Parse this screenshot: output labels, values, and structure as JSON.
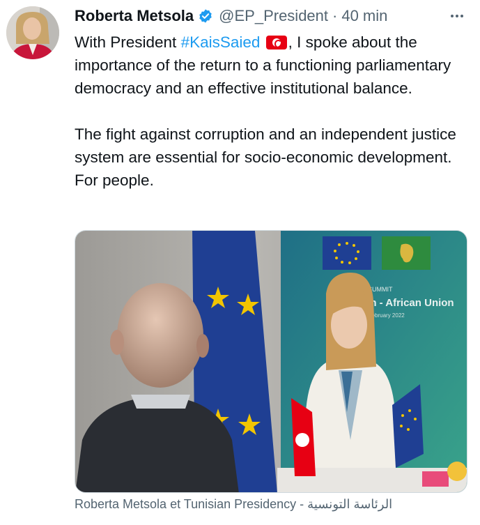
{
  "tweet": {
    "author_name": "Roberta Metsola",
    "handle": "@EP_President",
    "separator": "·",
    "time": "40 min",
    "text_before_hashtag": "With President ",
    "hashtag": "#KaisSaied",
    "text_after_flag": ", I spoke about the importance of the return to a functioning parliamentary democracy and an effective institutional balance.",
    "paragraph2": "The fight against corruption and an independent justice system are essential for socio-economic development. For people.",
    "media_caption": "Roberta Metsola et Tunisian Presidency - الرئاسة التونسية",
    "media_banner_top": "6th SUMMIT",
    "media_banner_main": "Union - African Union",
    "media_banner_dates": "17-18 February 2022"
  },
  "colors": {
    "link": "#1d9bf0",
    "verified": "#1d9bf0",
    "secondary_text": "#536471",
    "eu_blue": "#1f3f93",
    "eu_star": "#f2c500",
    "tunisia_red": "#e70013"
  },
  "icons": {
    "verified": "verified-badge-icon",
    "more": "more-options-icon",
    "flag": "tunisia-flag-icon"
  }
}
